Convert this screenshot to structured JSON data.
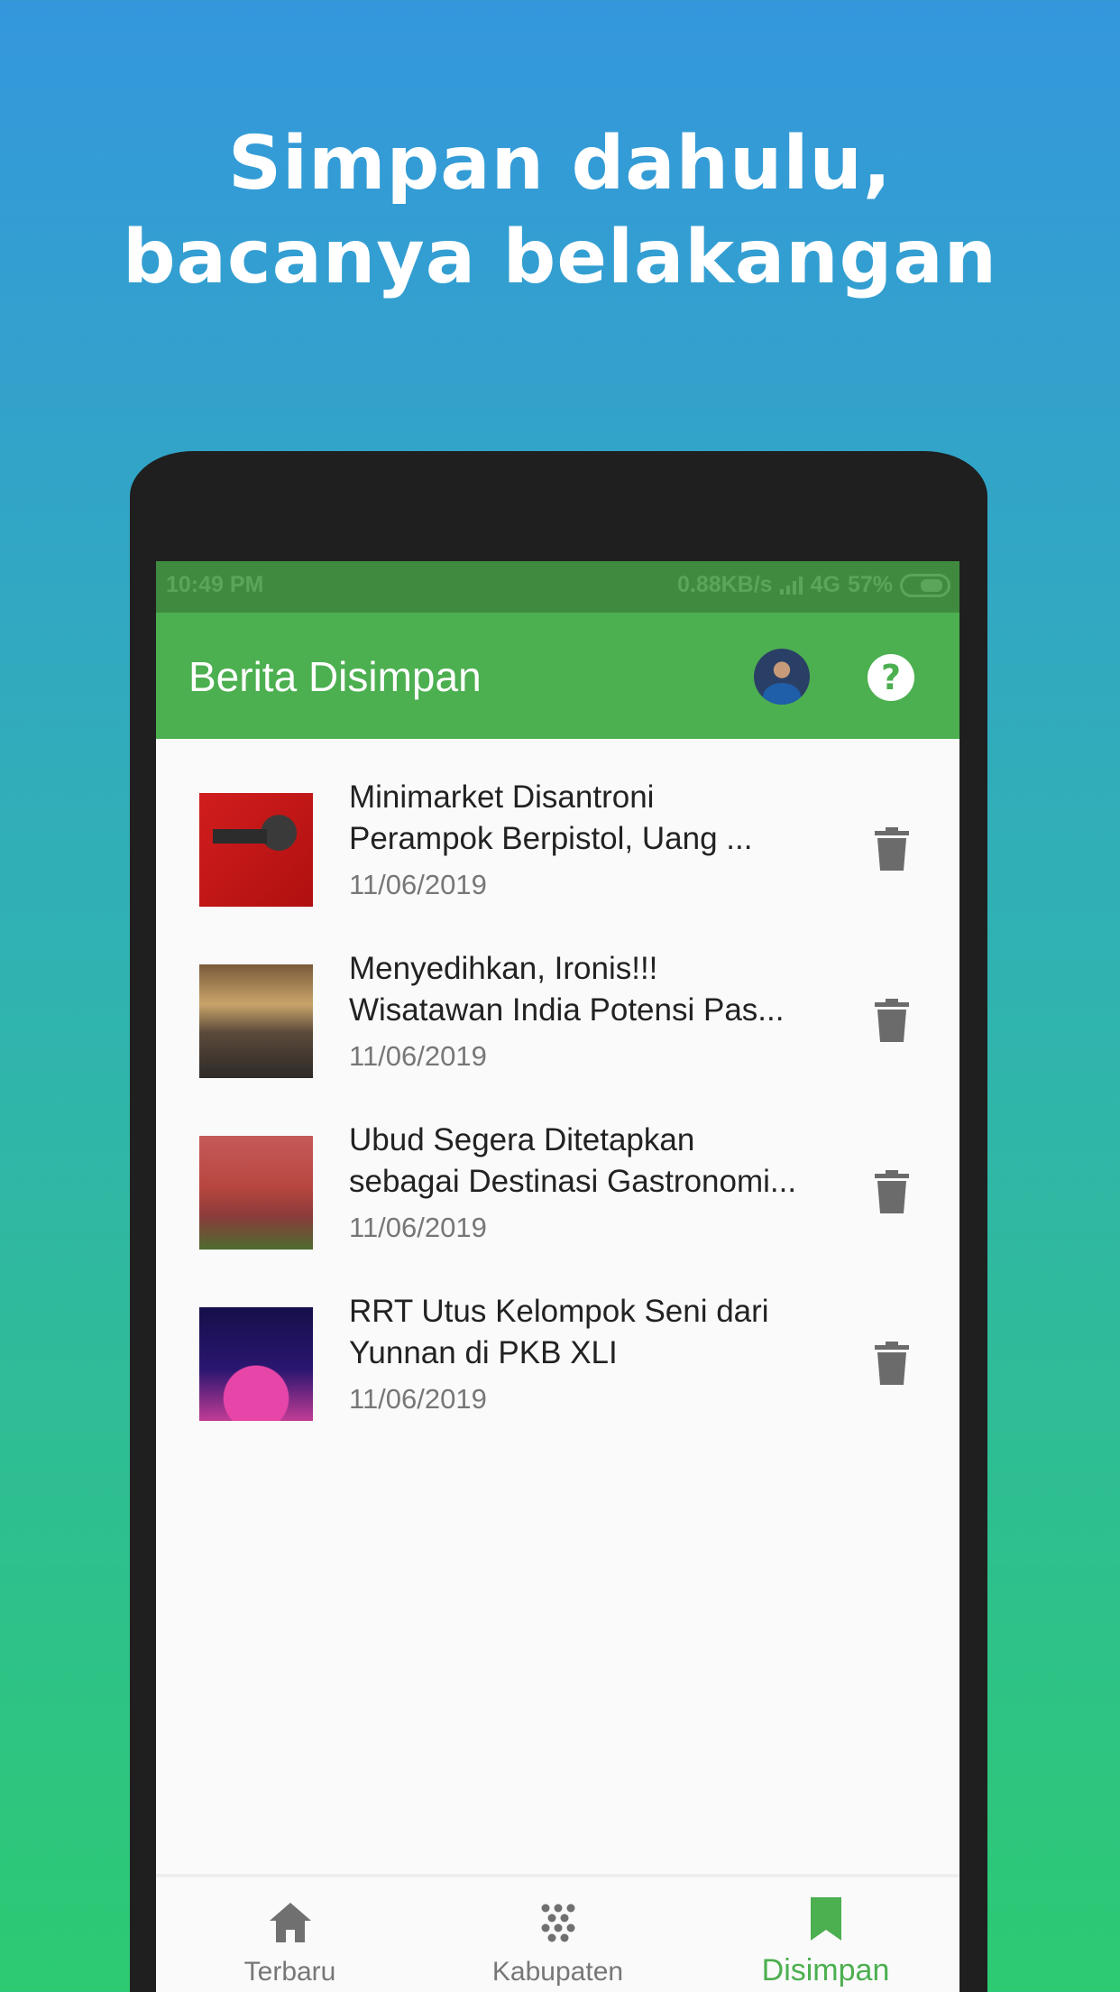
{
  "headline": {
    "line1": "Simpan dahulu,",
    "line2": "bacanya belakangan"
  },
  "statusbar": {
    "time": "10:49 PM",
    "speed": "0.88KB/s",
    "network": "4G",
    "battery": "57%"
  },
  "appbar": {
    "title": "Berita Disimpan",
    "avatar_icon": "user-avatar",
    "help_icon": "help-icon"
  },
  "articles": [
    {
      "title_line1": "Minimarket Disantroni",
      "title_line2": "Perampok Berpistol, Uang ...",
      "date": "11/06/2019"
    },
    {
      "title_line1": "Menyedihkan, Ironis!!!",
      "title_line2": "Wisatawan India Potensi Pas...",
      "date": "11/06/2019"
    },
    {
      "title_line1": "Ubud Segera Ditetapkan",
      "title_line2": "sebagai Destinasi Gastronomi...",
      "date": "11/06/2019"
    },
    {
      "title_line1": "RRT Utus Kelompok Seni dari",
      "title_line2": "Yunnan di PKB XLI",
      "date": "11/06/2019"
    }
  ],
  "bottom_nav": [
    {
      "label": "Terbaru",
      "icon": "home-icon",
      "active": false
    },
    {
      "label": "Kabupaten",
      "icon": "dots-grid-icon",
      "active": false
    },
    {
      "label": "Disimpan",
      "icon": "bookmark-icon",
      "active": true
    }
  ],
  "colors": {
    "primary_green": "#4caf50",
    "statusbar_green": "#3f8a3f",
    "gradient_top": "#3497dd",
    "gradient_bottom": "#2dca72",
    "phone_frame": "#1f1f1f"
  }
}
